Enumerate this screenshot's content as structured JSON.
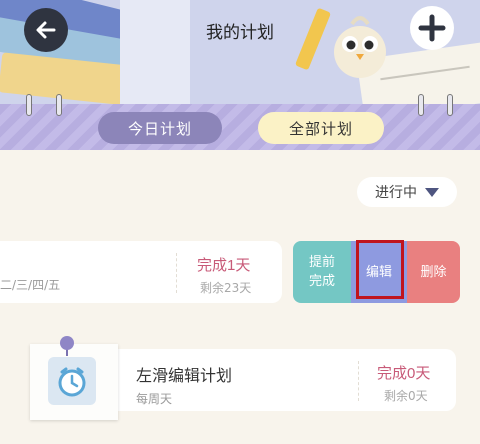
{
  "header": {
    "title": "我的计划",
    "back_icon": "arrow-left-icon",
    "add_icon": "plus-icon"
  },
  "tabs": [
    {
      "label": "今日计划",
      "active": false
    },
    {
      "label": "全部计划",
      "active": true
    }
  ],
  "filter": {
    "selected": "进行中",
    "icon": "caret-down-icon"
  },
  "plans": [
    {
      "frequency": "二/三/四/五",
      "status": "完成1天",
      "remaining": "剩余23天",
      "swiped": true,
      "actions": {
        "finish_line1": "提前",
        "finish_line2": "完成",
        "edit": "编辑",
        "delete": "删除"
      }
    },
    {
      "name": "左滑编辑计划",
      "frequency": "每周天",
      "status": "完成0天",
      "remaining": "剩余0天",
      "icon": "alarm-clock-icon"
    }
  ],
  "colors": {
    "accent_purple": "#8c85b9",
    "active_tab_bg": "#fbf2c6",
    "status_pink": "#c85a78",
    "finish_teal": "#74c7c4",
    "edit_blue": "#8e9ae0",
    "delete_red": "#e98080",
    "highlight_red": "#c0141d"
  }
}
